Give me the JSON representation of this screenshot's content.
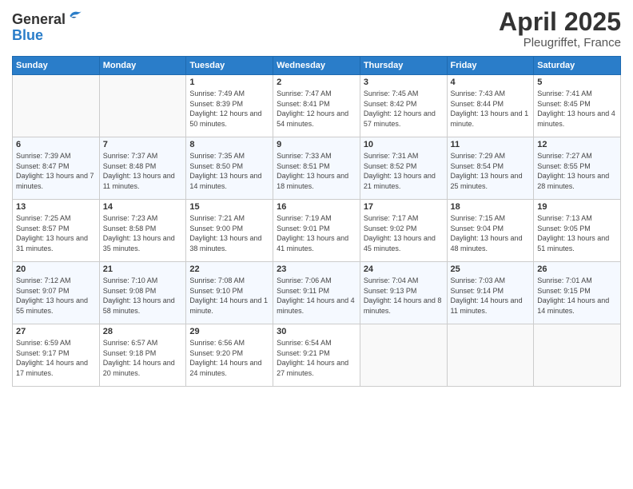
{
  "header": {
    "logo_line1": "General",
    "logo_line2": "Blue",
    "title": "April 2025",
    "subtitle": "Pleugriffet, France"
  },
  "columns": [
    "Sunday",
    "Monday",
    "Tuesday",
    "Wednesday",
    "Thursday",
    "Friday",
    "Saturday"
  ],
  "weeks": [
    [
      {
        "day": "",
        "info": ""
      },
      {
        "day": "",
        "info": ""
      },
      {
        "day": "1",
        "info": "Sunrise: 7:49 AM\nSunset: 8:39 PM\nDaylight: 12 hours and 50 minutes."
      },
      {
        "day": "2",
        "info": "Sunrise: 7:47 AM\nSunset: 8:41 PM\nDaylight: 12 hours and 54 minutes."
      },
      {
        "day": "3",
        "info": "Sunrise: 7:45 AM\nSunset: 8:42 PM\nDaylight: 12 hours and 57 minutes."
      },
      {
        "day": "4",
        "info": "Sunrise: 7:43 AM\nSunset: 8:44 PM\nDaylight: 13 hours and 1 minute."
      },
      {
        "day": "5",
        "info": "Sunrise: 7:41 AM\nSunset: 8:45 PM\nDaylight: 13 hours and 4 minutes."
      }
    ],
    [
      {
        "day": "6",
        "info": "Sunrise: 7:39 AM\nSunset: 8:47 PM\nDaylight: 13 hours and 7 minutes."
      },
      {
        "day": "7",
        "info": "Sunrise: 7:37 AM\nSunset: 8:48 PM\nDaylight: 13 hours and 11 minutes."
      },
      {
        "day": "8",
        "info": "Sunrise: 7:35 AM\nSunset: 8:50 PM\nDaylight: 13 hours and 14 minutes."
      },
      {
        "day": "9",
        "info": "Sunrise: 7:33 AM\nSunset: 8:51 PM\nDaylight: 13 hours and 18 minutes."
      },
      {
        "day": "10",
        "info": "Sunrise: 7:31 AM\nSunset: 8:52 PM\nDaylight: 13 hours and 21 minutes."
      },
      {
        "day": "11",
        "info": "Sunrise: 7:29 AM\nSunset: 8:54 PM\nDaylight: 13 hours and 25 minutes."
      },
      {
        "day": "12",
        "info": "Sunrise: 7:27 AM\nSunset: 8:55 PM\nDaylight: 13 hours and 28 minutes."
      }
    ],
    [
      {
        "day": "13",
        "info": "Sunrise: 7:25 AM\nSunset: 8:57 PM\nDaylight: 13 hours and 31 minutes."
      },
      {
        "day": "14",
        "info": "Sunrise: 7:23 AM\nSunset: 8:58 PM\nDaylight: 13 hours and 35 minutes."
      },
      {
        "day": "15",
        "info": "Sunrise: 7:21 AM\nSunset: 9:00 PM\nDaylight: 13 hours and 38 minutes."
      },
      {
        "day": "16",
        "info": "Sunrise: 7:19 AM\nSunset: 9:01 PM\nDaylight: 13 hours and 41 minutes."
      },
      {
        "day": "17",
        "info": "Sunrise: 7:17 AM\nSunset: 9:02 PM\nDaylight: 13 hours and 45 minutes."
      },
      {
        "day": "18",
        "info": "Sunrise: 7:15 AM\nSunset: 9:04 PM\nDaylight: 13 hours and 48 minutes."
      },
      {
        "day": "19",
        "info": "Sunrise: 7:13 AM\nSunset: 9:05 PM\nDaylight: 13 hours and 51 minutes."
      }
    ],
    [
      {
        "day": "20",
        "info": "Sunrise: 7:12 AM\nSunset: 9:07 PM\nDaylight: 13 hours and 55 minutes."
      },
      {
        "day": "21",
        "info": "Sunrise: 7:10 AM\nSunset: 9:08 PM\nDaylight: 13 hours and 58 minutes."
      },
      {
        "day": "22",
        "info": "Sunrise: 7:08 AM\nSunset: 9:10 PM\nDaylight: 14 hours and 1 minute."
      },
      {
        "day": "23",
        "info": "Sunrise: 7:06 AM\nSunset: 9:11 PM\nDaylight: 14 hours and 4 minutes."
      },
      {
        "day": "24",
        "info": "Sunrise: 7:04 AM\nSunset: 9:13 PM\nDaylight: 14 hours and 8 minutes."
      },
      {
        "day": "25",
        "info": "Sunrise: 7:03 AM\nSunset: 9:14 PM\nDaylight: 14 hours and 11 minutes."
      },
      {
        "day": "26",
        "info": "Sunrise: 7:01 AM\nSunset: 9:15 PM\nDaylight: 14 hours and 14 minutes."
      }
    ],
    [
      {
        "day": "27",
        "info": "Sunrise: 6:59 AM\nSunset: 9:17 PM\nDaylight: 14 hours and 17 minutes."
      },
      {
        "day": "28",
        "info": "Sunrise: 6:57 AM\nSunset: 9:18 PM\nDaylight: 14 hours and 20 minutes."
      },
      {
        "day": "29",
        "info": "Sunrise: 6:56 AM\nSunset: 9:20 PM\nDaylight: 14 hours and 24 minutes."
      },
      {
        "day": "30",
        "info": "Sunrise: 6:54 AM\nSunset: 9:21 PM\nDaylight: 14 hours and 27 minutes."
      },
      {
        "day": "",
        "info": ""
      },
      {
        "day": "",
        "info": ""
      },
      {
        "day": "",
        "info": ""
      }
    ]
  ]
}
